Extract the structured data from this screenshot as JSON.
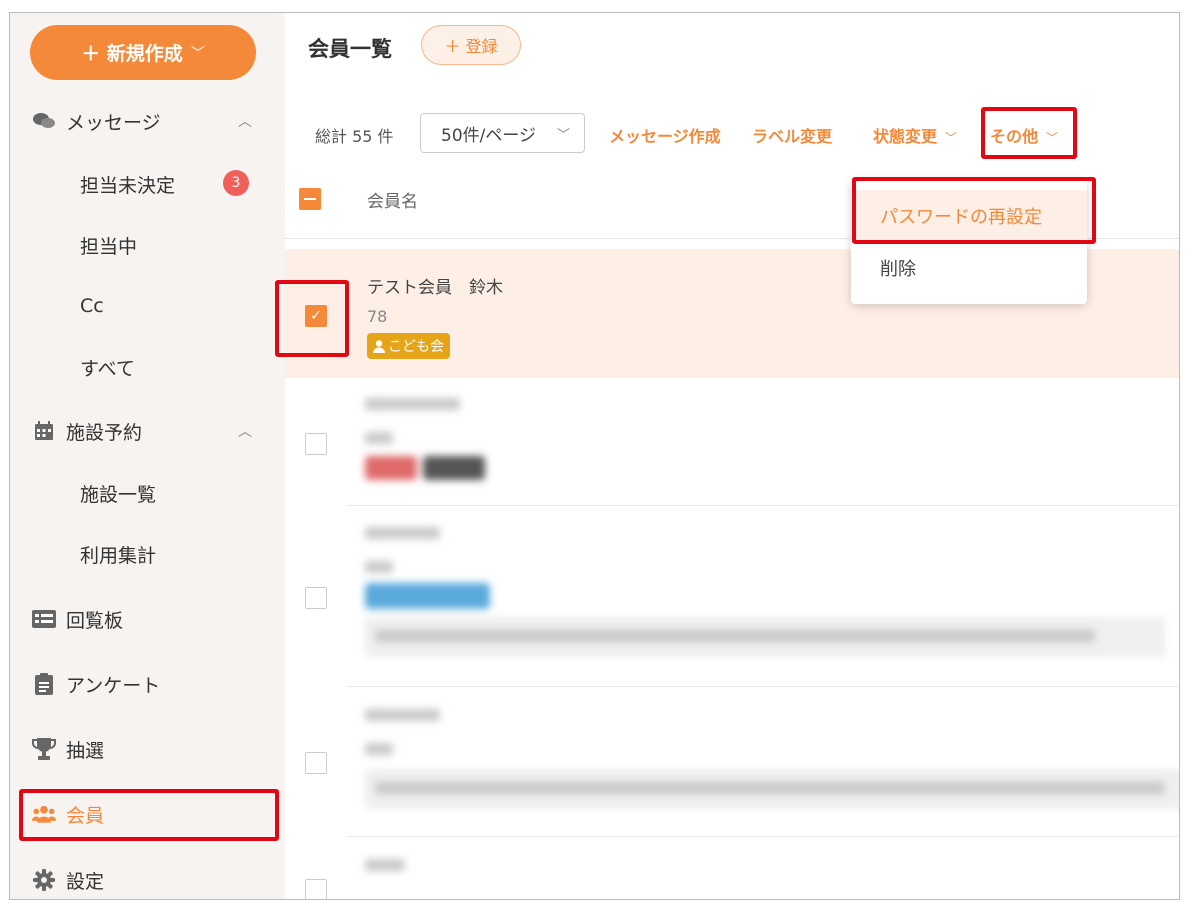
{
  "sidebar": {
    "new_button": {
      "label": "＋ 新規作成",
      "chevron": "﹀"
    },
    "messages": {
      "label": "メッセージ",
      "icon": "chat-icon",
      "caret": "︿",
      "sub": [
        {
          "label": "担当未決定",
          "badge": "3"
        },
        {
          "label": "担当中"
        },
        {
          "label": "Cc"
        },
        {
          "label": "すべて"
        }
      ]
    },
    "facilities": {
      "label": "施設予約",
      "icon": "calendar-icon",
      "caret": "︿",
      "sub": [
        {
          "label": "施設一覧"
        },
        {
          "label": "利用集計"
        }
      ]
    },
    "board": {
      "label": "回覧板",
      "icon": "board-icon"
    },
    "survey": {
      "label": "アンケート",
      "icon": "clipboard-icon"
    },
    "lottery": {
      "label": "抽選",
      "icon": "trophy-icon"
    },
    "members": {
      "label": "会員",
      "icon": "users-icon"
    },
    "settings": {
      "label": "設定",
      "icon": "gear-icon"
    }
  },
  "header": {
    "title": "会員一覧",
    "register_label": "＋ 登録"
  },
  "toolbar": {
    "total": "総計 55 件",
    "per_page": "50件/ページ",
    "compose": "メッセージ作成",
    "label_change": "ラベル変更",
    "status_change": "状態変更",
    "other": "その他"
  },
  "table": {
    "column_name": "会員名"
  },
  "members": [
    {
      "name": "テスト会員　鈴木",
      "id": "78",
      "tag": "こども会",
      "selected": true
    }
  ],
  "dropdown": {
    "items": [
      "パスワードの再設定",
      "削除"
    ]
  },
  "colors": {
    "accent": "#f5893a",
    "highlight_box": "#e30613",
    "badge": "#f0605b",
    "tag": "#e6a519"
  }
}
